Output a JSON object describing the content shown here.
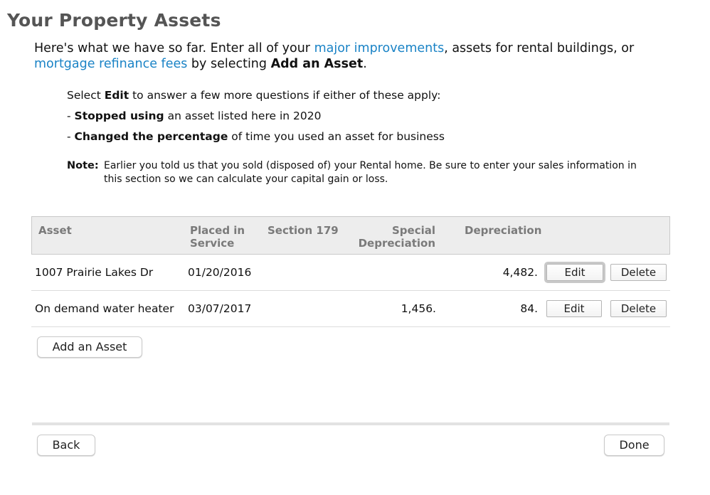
{
  "page": {
    "title": "Your Property Assets"
  },
  "intro": {
    "text1": "Here's what we have so far. Enter all of your ",
    "link1": "major improvements",
    "text2": ", assets for rental buildings, or ",
    "link2": "mortgage refinance fees",
    "text3": " by selecting ",
    "bold": "Add an Asset",
    "text4": "."
  },
  "instructions": {
    "line1_pre": "Select ",
    "line1_bold": "Edit",
    "line1_post": " to answer a few more questions if either of these apply:",
    "line2_pre": "- ",
    "line2_bold": "Stopped using",
    "line2_post": " an asset listed here in 2020",
    "line3_pre": "- ",
    "line3_bold": "Changed the percentage",
    "line3_post": " of time you used an asset for business"
  },
  "note": {
    "label": "Note:",
    "text": "Earlier you told us that you sold (disposed of) your Rental home. Be sure to enter your sales information in this section so we can calculate your capital gain or loss."
  },
  "table": {
    "headers": {
      "asset": "Asset",
      "placed_line1": "Placed in",
      "placed_line2": "Service",
      "section179": "Section 179",
      "special_line1": "Special",
      "special_line2": "Depreciation",
      "depreciation": "Depreciation"
    },
    "rows": [
      {
        "asset": "1007 Prairie Lakes Dr",
        "placed": "01/20/2016",
        "section179": "",
        "special": "",
        "depreciation": "4,482.",
        "edit": "Edit",
        "delete": "Delete"
      },
      {
        "asset": "On demand water heater",
        "placed": "03/07/2017",
        "section179": "",
        "special": "1,456.",
        "depreciation": "84.",
        "edit": "Edit",
        "delete": "Delete"
      }
    ]
  },
  "buttons": {
    "add_asset": "Add an Asset",
    "back": "Back",
    "done": "Done"
  }
}
